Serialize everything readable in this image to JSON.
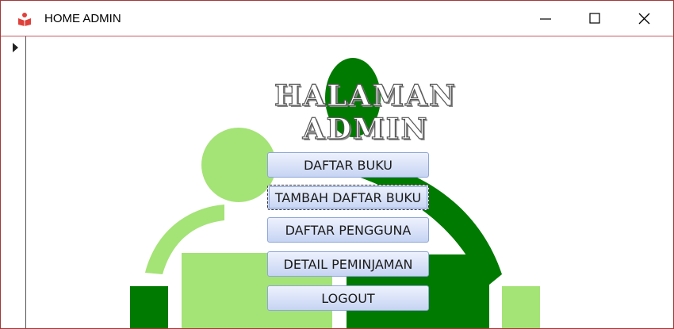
{
  "window": {
    "title": "HOME ADMIN",
    "app_icon": "books-app-icon"
  },
  "page": {
    "heading": "HALAMAN ADMIN"
  },
  "menu": {
    "daftar_buku": "DAFTAR BUKU",
    "tambah_daftar_buku": "TAMBAH DAFTAR BUKU",
    "daftar_pengguna": "DAFTAR PENGGUNA",
    "detail_peminjaman": "DETAIL PEMINJAMAN",
    "logout": "LOGOUT"
  },
  "colors": {
    "window_border": "#a0393c",
    "logo_dark_green": "#007a00",
    "logo_light_green": "#a4e376",
    "button_gradient_top": "#eef2fd",
    "button_gradient_bottom": "#c6d4f3"
  }
}
